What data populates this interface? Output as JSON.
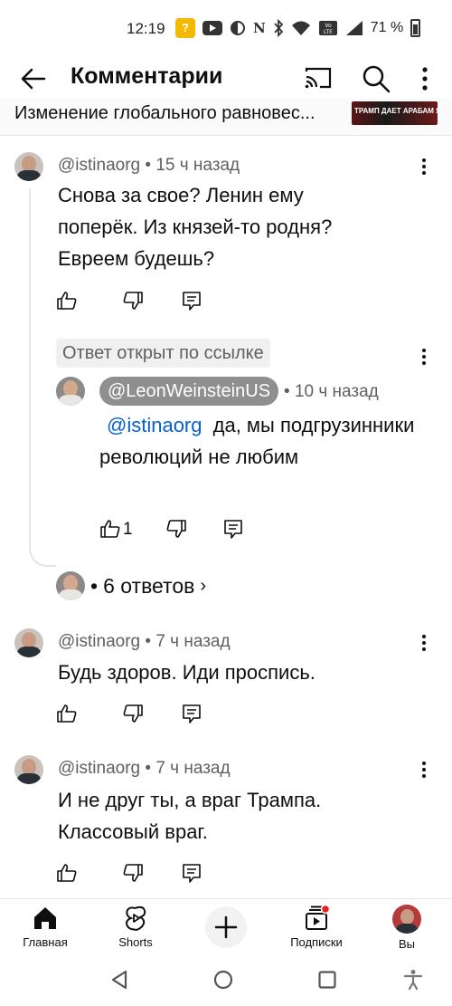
{
  "status_bar": {
    "time": "12:19",
    "key_badge": "?",
    "network_letter": "N",
    "battery": "71 %"
  },
  "app_bar": {
    "title": "Комментарии",
    "icons": [
      "back-arrow-icon",
      "cast-icon",
      "search-icon",
      "more-vert-icon"
    ]
  },
  "video": {
    "title": "Изменение глобального равновес...",
    "thumbnail_caption": "ТРАМП ДАЕТ АРАБАМ ЯДЕРКУ"
  },
  "comments": [
    {
      "author": "@istinaorg",
      "sep": "•",
      "time": "15 ч назад",
      "text": "Снова за свое? Ленин ему поперёк. Из князей-то родня? Евреем будешь?"
    },
    {
      "author": "@istinaorg",
      "sep": "•",
      "time": "7 ч назад",
      "text": "Будь здоров. Иди проспись."
    },
    {
      "author": "@istinaorg",
      "sep": "•",
      "time": "7 ч назад",
      "text": "И не друг ты, а враг Трампа. Классовый враг."
    }
  ],
  "linked_reply": {
    "badge": "Ответ открыт по ссылке",
    "author": "@LeonWeinsteinUS",
    "sep": "•",
    "time": "10 ч назад",
    "mention": "@istinaorg",
    "text": "да, мы подгрузинники революций не любим",
    "like_count": "1"
  },
  "replies_link": {
    "sep": "•",
    "label": "6 ответов",
    "chevron": "›"
  },
  "bottom_nav": {
    "items": [
      {
        "label": "Главная",
        "icon": "home-icon"
      },
      {
        "label": "Shorts",
        "icon": "shorts-icon"
      },
      {
        "label": "",
        "icon": "add-icon"
      },
      {
        "label": "Подписки",
        "icon": "subscriptions-icon"
      },
      {
        "label": "Вы",
        "icon": "avatar"
      }
    ]
  },
  "colors": {
    "text_primary": "#0f0f0f",
    "text_secondary": "#606060",
    "link": "#065fd4",
    "notification_dot": "#e62117"
  }
}
